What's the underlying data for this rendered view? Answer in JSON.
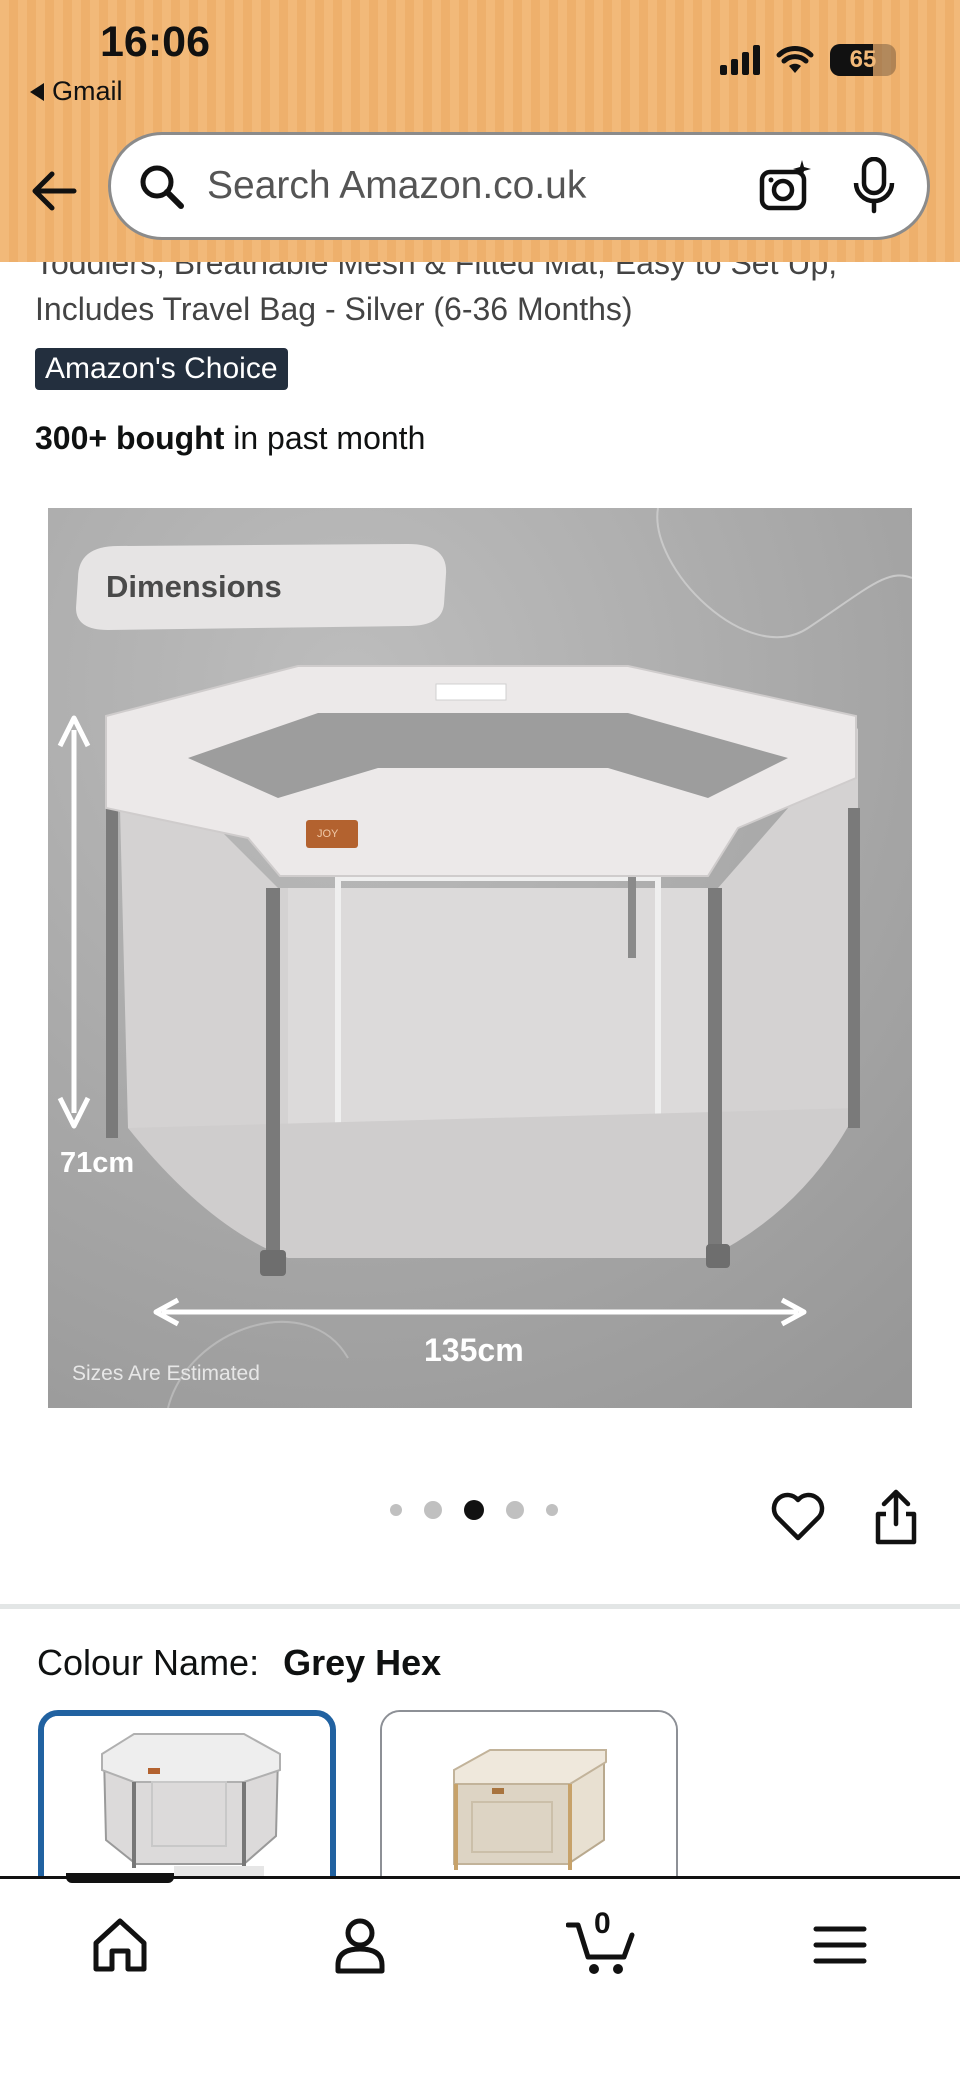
{
  "status_bar": {
    "time": "16:06",
    "back_app": "Gmail",
    "battery": "65",
    "battery_level": 0.65
  },
  "search": {
    "placeholder": "Search Amazon.co.uk"
  },
  "product": {
    "title_line1": "Toddlers, Breathable Mesh & Fitted Mat, Easy to Set Up,",
    "title_line2": "Includes Travel Bag - Silver (6-36 Months)",
    "badge": "Amazon's Choice",
    "bought_count": "300+ bought",
    "bought_suffix": "in past month"
  },
  "image": {
    "label": "Dimensions",
    "height_label": "71cm",
    "width_label": "135cm",
    "note": "Sizes Are Estimated",
    "tag": "JOY"
  },
  "carousel": {
    "count": 5,
    "active": 2
  },
  "colour": {
    "label": "Colour Name:",
    "value": "Grey Hex"
  },
  "bottom_nav": {
    "cart_count": "0"
  },
  "colors": {
    "header_bg": "#f2b979",
    "badge_bg": "#232f3e",
    "selected_border": "#2162a1"
  }
}
